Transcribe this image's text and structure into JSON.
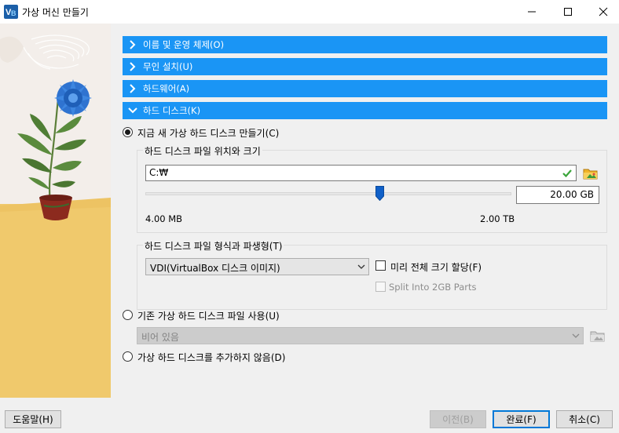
{
  "window": {
    "title": "가상 머신 만들기",
    "app_icon": "virtualbox-logo-icon"
  },
  "sections": [
    {
      "label": "이름 및 운영 체제(O)",
      "expanded": false
    },
    {
      "label": "무인 설치(U)",
      "expanded": false
    },
    {
      "label": "하드웨어(A)",
      "expanded": false
    },
    {
      "label": "하드 디스크(K)",
      "expanded": true
    }
  ],
  "disk": {
    "create_new_label": "지금 새 가상 하드 디스크 만들기(C)",
    "create_new_selected": true,
    "location_group_title": "하드 디스크 파일 위치와 크기",
    "path_value": "C:₩",
    "size_value": "20.00 GB",
    "slider_min_label": "4.00 MB",
    "slider_max_label": "2.00 TB",
    "slider_fraction": 0.64,
    "format_group_title": "하드 디스크 파일 형식과 파생형(T)",
    "format_selected": "VDI(VirtualBox 디스크 이미지)",
    "preallocate_label": "미리 전체 크기 할당(F)",
    "preallocate_checked": false,
    "split_label": "Split Into 2GB Parts",
    "split_checked": false,
    "use_existing_label": "기존 가상 하드 디스크 파일 사용(U)",
    "existing_placeholder": "비어 있음",
    "no_disk_label": "가상 하드 디스크를 추가하지 않음(D)"
  },
  "footer": {
    "help_label": "도움말(H)",
    "back_label": "이전(B)",
    "finish_label": "완료(F)",
    "cancel_label": "취소(C)"
  },
  "colors": {
    "section_bar": "#1a95f5",
    "accent": "#0078d7",
    "valid_check": "#3aa53a"
  }
}
